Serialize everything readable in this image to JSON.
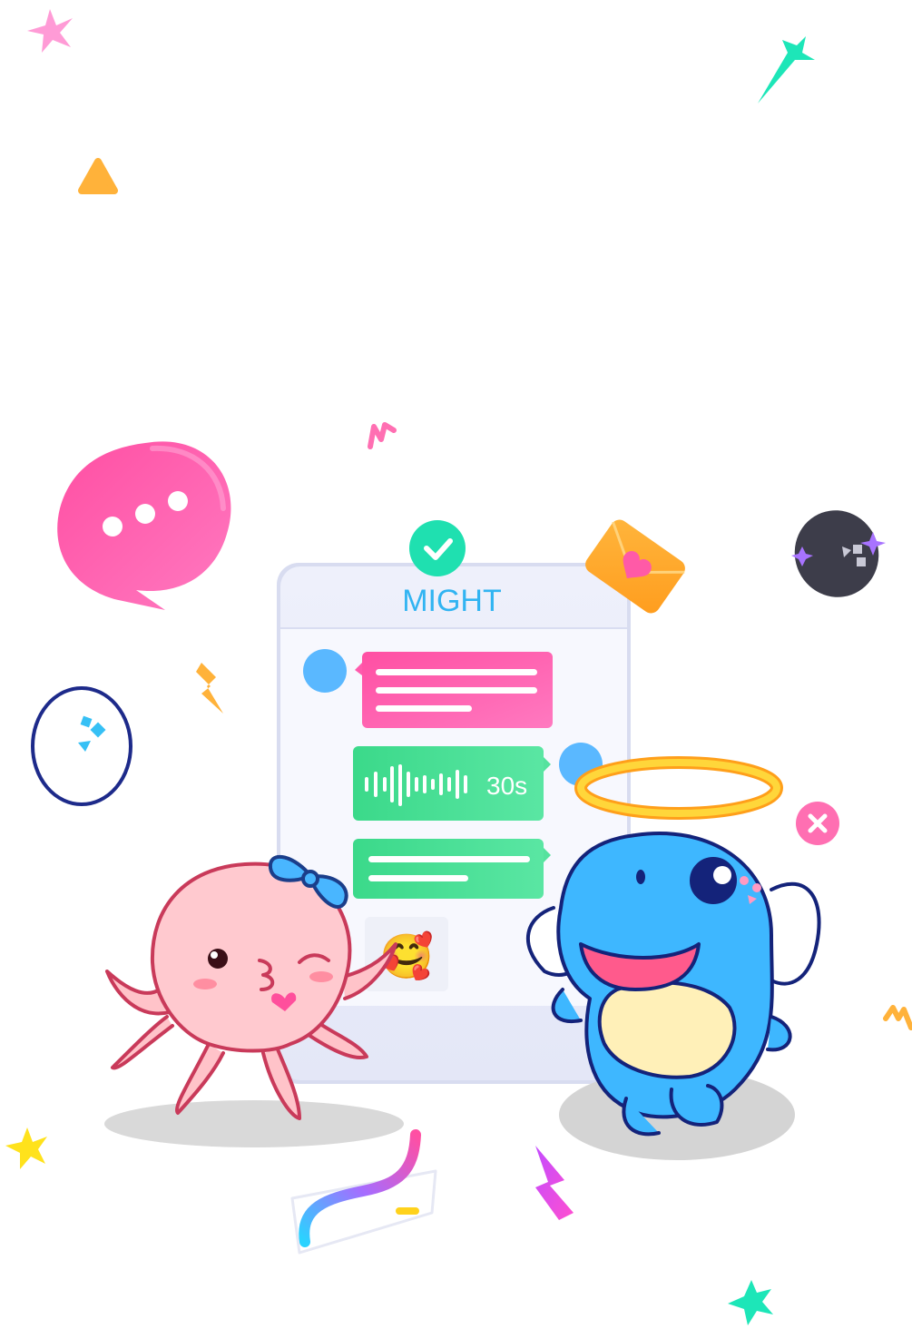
{
  "app": {
    "title": "MIGHT"
  },
  "chat": {
    "voice_duration": "30s",
    "emoji_sticker": "🥰"
  },
  "colors": {
    "brand_text": "#31b4f2",
    "pink_bubble": "#ff5fae",
    "green_bubble": "#2fdc86",
    "teal_accent": "#1fe0b0",
    "orange_accent": "#ffb23a",
    "blue_mascot": "#3cb4ff",
    "pink_mascot": "#ffc9cf"
  },
  "icons": [
    "check-icon",
    "heart-envelope-icon",
    "typing-bubble-icon",
    "close-icon",
    "halo-icon",
    "lightning-icon",
    "sparkle-icon"
  ]
}
